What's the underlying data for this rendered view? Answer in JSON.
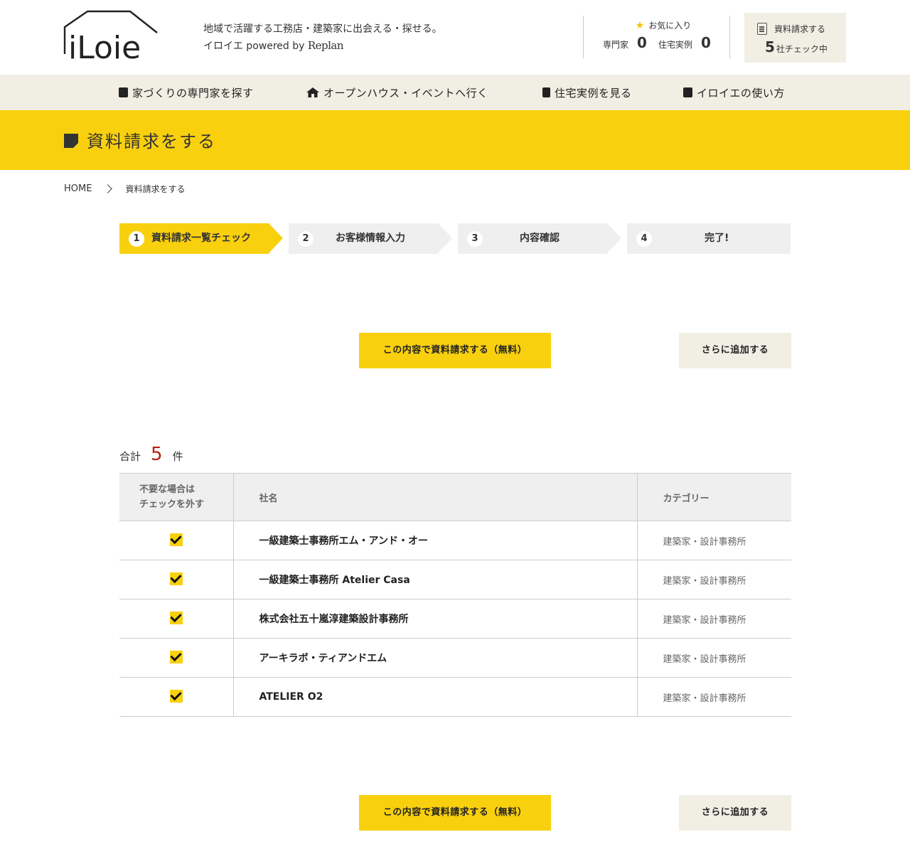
{
  "header": {
    "logo_text": "iLoie",
    "tagline_line1": "地域で活躍する工務店・建築家に出会える・探せる。",
    "tagline_line2_prefix": "イロイエ powered by",
    "tagline_brand": "Replan",
    "favorites": {
      "title": "お気に入り",
      "experts_label": "専門家",
      "experts_count": "0",
      "cases_label": "住宅実例",
      "cases_count": "0"
    },
    "request": {
      "title": "資料請求する",
      "count": "5",
      "count_suffix": "社チェック中"
    }
  },
  "nav": {
    "items": [
      {
        "label": "家づくりの専門家を探す",
        "icon": "person-card-icon"
      },
      {
        "label": "オープンハウス・イベントへ行く",
        "icon": "house-icon"
      },
      {
        "label": "住宅実例を見る",
        "icon": "document-icon"
      },
      {
        "label": "イロイエの使い方",
        "icon": "book-icon"
      }
    ]
  },
  "page_title": "資料請求をする",
  "breadcrumb": {
    "home": "HOME",
    "current": "資料請求をする"
  },
  "steps": [
    {
      "num": "1",
      "label": "資料請求一覧チェック"
    },
    {
      "num": "2",
      "label": "お客様情報入力"
    },
    {
      "num": "3",
      "label": "内容確認"
    },
    {
      "num": "4",
      "label": "完了!"
    }
  ],
  "buttons": {
    "submit": "この内容で資料請求する（無料）",
    "add_more": "さらに追加する"
  },
  "total": {
    "prefix": "合計",
    "count": "5",
    "suffix": "件"
  },
  "table": {
    "headers": {
      "check_line1": "不要な場合は",
      "check_line2": "チェックを外す",
      "name": "社名",
      "category": "カテゴリー"
    },
    "rows": [
      {
        "name": "一級建築士事務所エム・アンド・オー",
        "category": "建築家・設計事務所",
        "checked": true
      },
      {
        "name": "一級建築士事務所 Atelier Casa",
        "category": "建築家・設計事務所",
        "checked": true
      },
      {
        "name": "株式会社五十嵐淳建築設計事務所",
        "category": "建築家・設計事務所",
        "checked": true
      },
      {
        "name": "アーキラボ・ティアンドエム",
        "category": "建築家・設計事務所",
        "checked": true
      },
      {
        "name": "ATELIER O2",
        "category": "建築家・設計事務所",
        "checked": true
      }
    ]
  },
  "colors": {
    "accent": "#f9d00e",
    "beige": "#f1efe4",
    "count_red": "#b8200f"
  }
}
